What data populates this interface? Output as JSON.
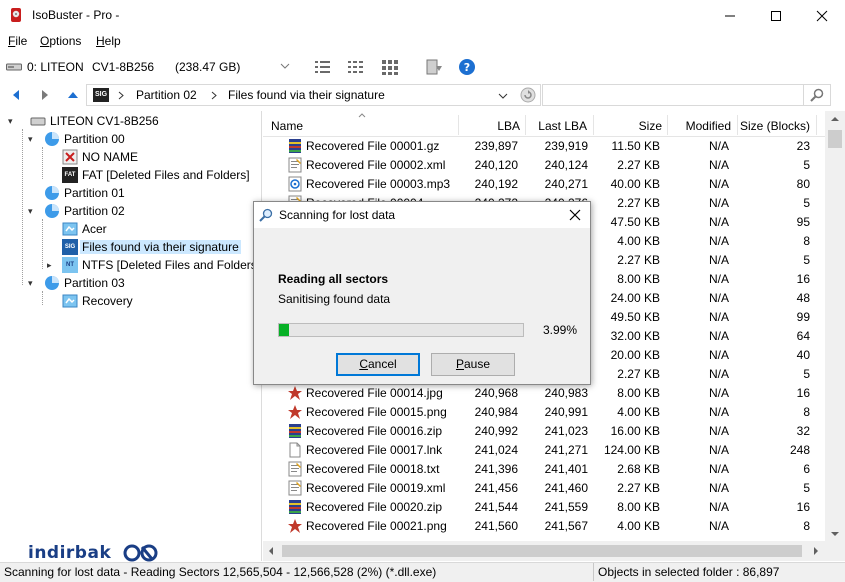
{
  "window": {
    "title": "IsoBuster - Pro -",
    "minimize_icon": "minimize-icon",
    "maximize_icon": "maximize-icon",
    "close_icon": "close-icon"
  },
  "menu": {
    "items": [
      {
        "key": "F",
        "rest": "ile"
      },
      {
        "key": "O",
        "rest": "ptions"
      },
      {
        "key": "H",
        "rest": "elp"
      }
    ]
  },
  "drive": {
    "id": "0: LITEON",
    "model": "CV1-8B256",
    "size": "(238.47 GB)"
  },
  "path": {
    "badge": "SIG",
    "segments": [
      "Partition 02",
      "Files found via their signature"
    ]
  },
  "search": {
    "placeholder": ""
  },
  "tree": {
    "items": [
      {
        "label": "LITEON CV1-8B256",
        "icon": "drive-icon"
      },
      {
        "label": "Partition 00",
        "icon": "partition-icon"
      },
      {
        "label": "NO NAME",
        "icon": "fat-volume-icon"
      },
      {
        "label": "FAT [Deleted Files and Folders]",
        "icon": "fat-badge-icon",
        "badge": "FAT"
      },
      {
        "label": "Partition 01",
        "icon": "partition-icon"
      },
      {
        "label": "Partition 02",
        "icon": "partition-icon"
      },
      {
        "label": "Acer",
        "icon": "ntfs-volume-icon"
      },
      {
        "label": "Files found via their signature",
        "icon": "sig-badge-icon",
        "badge": "SIG"
      },
      {
        "label": "NTFS [Deleted Files and Folders]",
        "icon": "ntfs-badge-icon",
        "badge": "NT"
      },
      {
        "label": "Partition 03",
        "icon": "partition-icon"
      },
      {
        "label": "Recovery",
        "icon": "ntfs-volume-icon"
      }
    ]
  },
  "list": {
    "columns": {
      "name": "Name",
      "lba": "LBA",
      "last_lba": "Last LBA",
      "size": "Size",
      "modified": "Modified",
      "size_blocks": "Size (Blocks)"
    },
    "rows": [
      {
        "name": "Recovered File 00001.gz",
        "lba": "239,897",
        "last": "239,919",
        "size": "11.50 KB",
        "mod": "N/A",
        "blocks": "23",
        "icon": "archive-file-icon"
      },
      {
        "name": "Recovered File 00002.xml",
        "lba": "240,120",
        "last": "240,124",
        "size": "2.27 KB",
        "mod": "N/A",
        "blocks": "5",
        "icon": "text-file-icon"
      },
      {
        "name": "Recovered File 00003.mp3",
        "lba": "240,192",
        "last": "240,271",
        "size": "40.00 KB",
        "mod": "N/A",
        "blocks": "80",
        "icon": "audio-file-icon"
      },
      {
        "name": "Recovered File 00004",
        "lba": "240,272",
        "last": "240,276",
        "size": "2.27 KB",
        "mod": "N/A",
        "blocks": "5",
        "icon": "text-file-icon"
      },
      {
        "name": "",
        "lba": "",
        "last": "",
        "size": "47.50 KB",
        "mod": "N/A",
        "blocks": "95",
        "icon": ""
      },
      {
        "name": "",
        "lba": "",
        "last": "",
        "size": "4.00 KB",
        "mod": "N/A",
        "blocks": "8",
        "icon": ""
      },
      {
        "name": "",
        "lba": "",
        "last": "",
        "size": "2.27 KB",
        "mod": "N/A",
        "blocks": "5",
        "icon": ""
      },
      {
        "name": "",
        "lba": "",
        "last": "",
        "size": "8.00 KB",
        "mod": "N/A",
        "blocks": "16",
        "icon": ""
      },
      {
        "name": "",
        "lba": "",
        "last": "",
        "size": "24.00 KB",
        "mod": "N/A",
        "blocks": "48",
        "icon": ""
      },
      {
        "name": "",
        "lba": "",
        "last": "",
        "size": "49.50 KB",
        "mod": "N/A",
        "blocks": "99",
        "icon": ""
      },
      {
        "name": "",
        "lba": "",
        "last": "",
        "size": "32.00 KB",
        "mod": "N/A",
        "blocks": "64",
        "icon": ""
      },
      {
        "name": "",
        "lba": "",
        "last": "",
        "size": "20.00 KB",
        "mod": "N/A",
        "blocks": "40",
        "icon": ""
      },
      {
        "name": "",
        "lba": "",
        "last": "",
        "size": "2.27 KB",
        "mod": "N/A",
        "blocks": "5",
        "icon": ""
      },
      {
        "name": "Recovered File 00014.jpg",
        "lba": "240,968",
        "last": "240,983",
        "size": "8.00 KB",
        "mod": "N/A",
        "blocks": "16",
        "icon": "image-file-icon"
      },
      {
        "name": "Recovered File 00015.png",
        "lba": "240,984",
        "last": "240,991",
        "size": "4.00 KB",
        "mod": "N/A",
        "blocks": "8",
        "icon": "image-file-icon"
      },
      {
        "name": "Recovered File 00016.zip",
        "lba": "240,992",
        "last": "241,023",
        "size": "16.00 KB",
        "mod": "N/A",
        "blocks": "32",
        "icon": "archive-file-icon"
      },
      {
        "name": "Recovered File 00017.lnk",
        "lba": "241,024",
        "last": "241,271",
        "size": "124.00 KB",
        "mod": "N/A",
        "blocks": "248",
        "icon": "blank-file-icon"
      },
      {
        "name": "Recovered File 00018.txt",
        "lba": "241,396",
        "last": "241,401",
        "size": "2.68 KB",
        "mod": "N/A",
        "blocks": "6",
        "icon": "text-file-icon"
      },
      {
        "name": "Recovered File 00019.xml",
        "lba": "241,456",
        "last": "241,460",
        "size": "2.27 KB",
        "mod": "N/A",
        "blocks": "5",
        "icon": "text-file-icon"
      },
      {
        "name": "Recovered File 00020.zip",
        "lba": "241,544",
        "last": "241,559",
        "size": "8.00 KB",
        "mod": "N/A",
        "blocks": "16",
        "icon": "archive-file-icon"
      },
      {
        "name": "Recovered File 00021.png",
        "lba": "241,560",
        "last": "241,567",
        "size": "4.00 KB",
        "mod": "N/A",
        "blocks": "8",
        "icon": "image-file-icon"
      }
    ]
  },
  "dialog": {
    "title": "Scanning for lost data",
    "line1": "Reading all sectors",
    "line2": "Sanitising found data",
    "progress": 0.0399,
    "progress_text": "3.99%",
    "cancel": {
      "key": "C",
      "rest": "ancel"
    },
    "pause": {
      "key": "P",
      "rest": "ause"
    }
  },
  "status": {
    "left": "Scanning for lost data - Reading Sectors 12,565,504 - 12,566,528  (2%) (*.dll.exe)",
    "right": "Objects in selected folder : 86,897"
  },
  "watermark": "indirbak"
}
